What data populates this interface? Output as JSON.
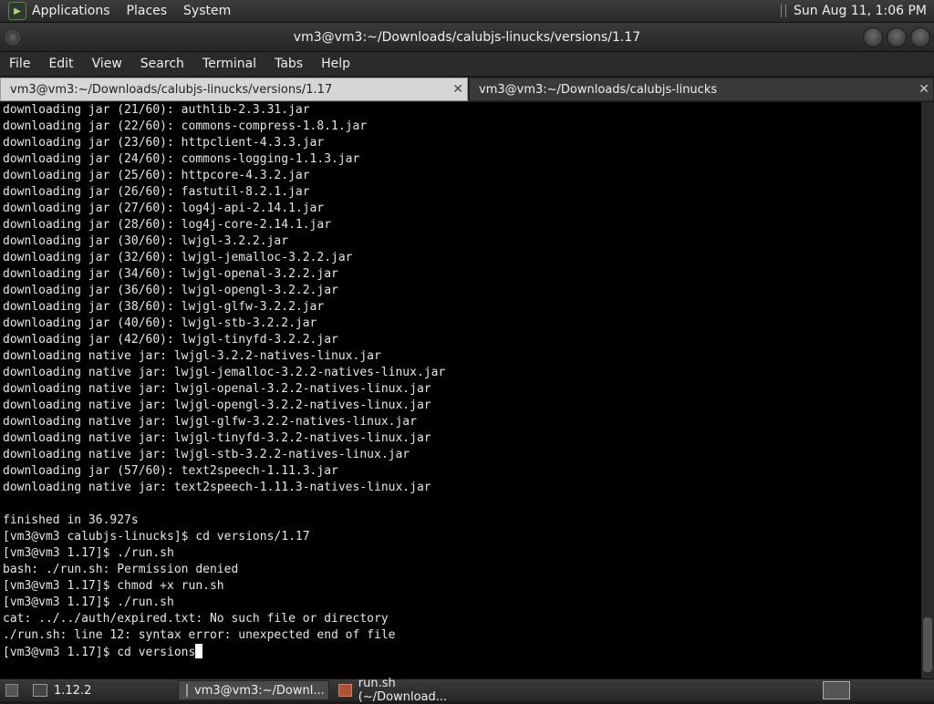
{
  "top_panel": {
    "menus": [
      "Applications",
      "Places",
      "System"
    ],
    "clock": "Sun Aug 11,  1:06 PM"
  },
  "window": {
    "title": "vm3@vm3:~/Downloads/calubjs-linucks/versions/1.17"
  },
  "menubar": [
    "File",
    "Edit",
    "View",
    "Search",
    "Terminal",
    "Tabs",
    "Help"
  ],
  "tabs": [
    {
      "label": "vm3@vm3:~/Downloads/calubjs-linucks/versions/1.17",
      "close": "✕"
    },
    {
      "label": "vm3@vm3:~/Downloads/calubjs-linucks",
      "close": "✕"
    }
  ],
  "terminal": {
    "lines": [
      "downloading jar (21/60): authlib-2.3.31.jar",
      "downloading jar (22/60): commons-compress-1.8.1.jar",
      "downloading jar (23/60): httpclient-4.3.3.jar",
      "downloading jar (24/60): commons-logging-1.1.3.jar",
      "downloading jar (25/60): httpcore-4.3.2.jar",
      "downloading jar (26/60): fastutil-8.2.1.jar",
      "downloading jar (27/60): log4j-api-2.14.1.jar",
      "downloading jar (28/60): log4j-core-2.14.1.jar",
      "downloading jar (30/60): lwjgl-3.2.2.jar",
      "downloading jar (32/60): lwjgl-jemalloc-3.2.2.jar",
      "downloading jar (34/60): lwjgl-openal-3.2.2.jar",
      "downloading jar (36/60): lwjgl-opengl-3.2.2.jar",
      "downloading jar (38/60): lwjgl-glfw-3.2.2.jar",
      "downloading jar (40/60): lwjgl-stb-3.2.2.jar",
      "downloading jar (42/60): lwjgl-tinyfd-3.2.2.jar",
      "downloading native jar: lwjgl-3.2.2-natives-linux.jar",
      "downloading native jar: lwjgl-jemalloc-3.2.2-natives-linux.jar",
      "downloading native jar: lwjgl-openal-3.2.2-natives-linux.jar",
      "downloading native jar: lwjgl-opengl-3.2.2-natives-linux.jar",
      "downloading native jar: lwjgl-glfw-3.2.2-natives-linux.jar",
      "downloading native jar: lwjgl-tinyfd-3.2.2-natives-linux.jar",
      "downloading native jar: lwjgl-stb-3.2.2-natives-linux.jar",
      "downloading jar (57/60): text2speech-1.11.3.jar",
      "downloading native jar: text2speech-1.11.3-natives-linux.jar",
      "",
      "finished in 36.927s",
      "[vm3@vm3 calubjs-linucks]$ cd versions/1.17",
      "[vm3@vm3 1.17]$ ./run.sh",
      "bash: ./run.sh: Permission denied",
      "[vm3@vm3 1.17]$ chmod +x run.sh",
      "[vm3@vm3 1.17]$ ./run.sh",
      "cat: ../../auth/expired.txt: No such file or directory",
      "./run.sh: line 12: syntax error: unexpected end of file",
      "[vm3@vm3 1.17]$ cd versions"
    ]
  },
  "taskbar": {
    "items": [
      {
        "label": "1.12.2",
        "icon": "folder-icon"
      },
      {
        "label": "vm3@vm3:~/Downl...",
        "icon": "terminal-icon"
      },
      {
        "label": "run.sh (~/Download...",
        "icon": "text-editor-icon"
      }
    ]
  }
}
